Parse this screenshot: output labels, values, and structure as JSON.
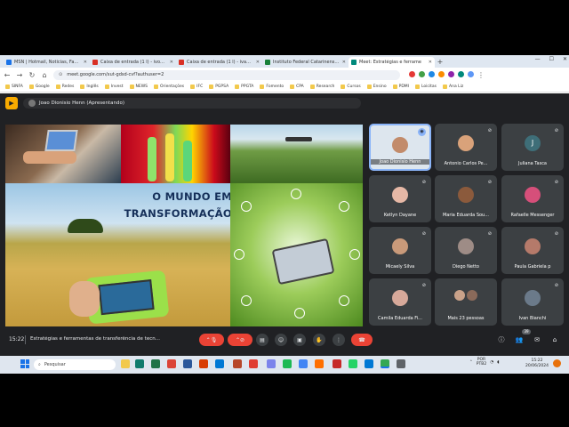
{
  "browser": {
    "tabs": [
      {
        "label": "MSN | Hotmail, Notícias, Famo",
        "color": "#1a73e8"
      },
      {
        "label": "Caixa de entrada (1 l) - ivonbo",
        "color": "#d93025"
      },
      {
        "label": "Caixa de entrada (1 l) - ivan.bi",
        "color": "#d93025"
      },
      {
        "label": "Instituto Federal Catarinense -",
        "color": "#188038"
      },
      {
        "label": "Meet: Estratégias e ferrame",
        "color": "#00897b",
        "active": true
      }
    ],
    "url": "meet.google.com/xut-gdsd-cvf?authuser=2",
    "bookmarks": [
      "SINFA",
      "Google",
      "Redes",
      "Inglês",
      "Invest",
      "NEWS",
      "Orientações",
      "IFC",
      "PGPSA",
      "PPGTA",
      "Fomento",
      "CPA",
      "Research",
      "Cursos",
      "Ensino",
      "PDMI",
      "Loicitas",
      "Ana Liz"
    ]
  },
  "meet": {
    "presenter": "Joao Dionisio Henn (Apresentando)",
    "slide_title_line1": "O MUNDO EM",
    "slide_title_line2": "TRANSFORMAÇÃO",
    "participants": [
      {
        "name": "Joao Dionisio Henn",
        "speaker": true,
        "color": "#c28b6a"
      },
      {
        "name": "Antonio Carlos Pe...",
        "color": "#d9a27a"
      },
      {
        "name": "Juliana Tasca",
        "initial": "J"
      },
      {
        "name": "Ketlyn Dayane",
        "color": "#e6b8a6"
      },
      {
        "name": "Maria Eduarda Sou...",
        "color": "#8b5a3c"
      },
      {
        "name": "Rafaelle Messenger",
        "color": "#d64f7a"
      },
      {
        "name": "Micaely Silva",
        "color": "#c99a7a"
      },
      {
        "name": "Diego Netto",
        "color": "#9e8c86"
      },
      {
        "name": "Paula Gabriela p",
        "color": "#b57a6a"
      },
      {
        "name": "Camila Eduarda Fi...",
        "color": "#d7a99a"
      },
      {
        "name": "Mais 23 pessoas",
        "color": "#a88"
      },
      {
        "name": "Ivan Bianchi",
        "color": "#6b7a8a"
      }
    ],
    "time": "15:22",
    "meeting_title": "Estratégias e ferramentas de transferência de tecn...",
    "participant_count": "39"
  },
  "taskbar": {
    "search_placeholder": "Pesquisar",
    "lang": "POR",
    "lang2": "PTB2",
    "clock_time": "15:22",
    "clock_date": "20/06/2024"
  }
}
